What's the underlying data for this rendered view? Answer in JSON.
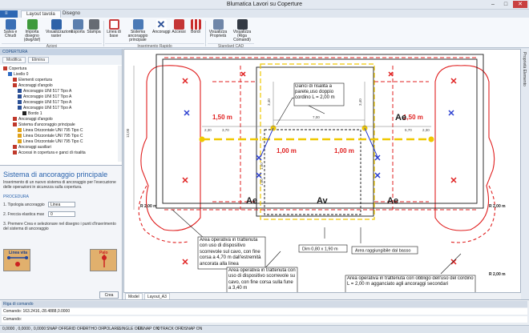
{
  "window": {
    "title": "Blumatica Lavori su Coperture",
    "minimize": "–",
    "maximize": "□",
    "close": "✕"
  },
  "tabs": [
    {
      "label": "Layout tavola"
    },
    {
      "label": "Disegno"
    }
  ],
  "ribbon": {
    "buttons": [
      {
        "label": "Salva e Chiudi",
        "icon": "save-icon",
        "color": "#3a6fb5"
      },
      {
        "label": "Importa disegno (dwg/dxf)",
        "icon": "import-icon",
        "color": "#3f9a3c"
      },
      {
        "label": "Visualizzazione raster",
        "icon": "raster-icon",
        "color": "#2d62a8"
      },
      {
        "label": "Esporta",
        "icon": "export-icon",
        "color": "#5b7fae"
      },
      {
        "label": "Stampa",
        "icon": "print-icon",
        "color": "#666b73"
      },
      {
        "label": "Linea di base",
        "icon": "baseline-icon",
        "color": "#c83b3b"
      },
      {
        "label": "Sistema ancoraggio principale",
        "icon": "anchor-system-icon",
        "color": "#4b7ab6"
      },
      {
        "label": "Ancoraggi",
        "icon": "anchor-x-icon",
        "color": "#2a4f96"
      },
      {
        "label": "Accessi",
        "icon": "access-icon",
        "color": "#c43535"
      },
      {
        "label": "Bordi",
        "icon": "edges-icon",
        "color": "#c92d2d"
      },
      {
        "label": "Visualizza Proprietà",
        "icon": "properties-icon",
        "color": "#6f86a8"
      },
      {
        "label": "Visualizza (Riga Comandi)",
        "icon": "command-line-icon",
        "color": "#333a44"
      }
    ],
    "groups": [
      {
        "label": "Azioni"
      },
      {
        "label": "Inserimento Rapido"
      },
      {
        "label": "Standard CAD"
      }
    ]
  },
  "left_panel": {
    "header": "COPERTURA",
    "tree_buttons": [
      "Modifica",
      "Elimina"
    ],
    "tree": [
      {
        "label": "Copertura",
        "level": 0,
        "color": "#c0392b"
      },
      {
        "label": "Livello 0",
        "level": 1,
        "color": "#2e6bc4"
      },
      {
        "label": "Elementi copertura",
        "level": 2,
        "color": "#c0392b"
      },
      {
        "label": "Ancoraggi d'angolo",
        "level": 2,
        "color": "#c0392b"
      },
      {
        "label": "Ancoraggio UNI 517 Tipo A",
        "level": 3,
        "color": "#2a4f96"
      },
      {
        "label": "Ancoraggio UNI 517 Tipo A",
        "level": 3,
        "color": "#2a4f96"
      },
      {
        "label": "Ancoraggio UNI 517 Tipo A",
        "level": 3,
        "color": "#2a4f96"
      },
      {
        "label": "Ancoraggio UNI 517 Tipo A",
        "level": 3,
        "color": "#2a4f96"
      },
      {
        "label": "Bordo 1",
        "level": 4,
        "color": "#222222"
      },
      {
        "label": "Ancoraggi d'angolo",
        "level": 2,
        "color": "#c0392b"
      },
      {
        "label": "Sistema d'ancoraggio principale",
        "level": 2,
        "color": "#c0392b"
      },
      {
        "label": "Linea Orizzontale UNI 795 Tipo C",
        "level": 3,
        "color": "#e0a21a"
      },
      {
        "label": "Linea Orizzontale UNI 795 Tipo C",
        "level": 3,
        "color": "#e0a21a"
      },
      {
        "label": "Linea Orizzontale UNI 795 Tipo C",
        "level": 3,
        "color": "#e0a21a"
      },
      {
        "label": "Ancoraggi ausiliari",
        "level": 2,
        "color": "#c0392b"
      },
      {
        "label": "Accessi in copertura e ganci di risalita",
        "level": 2,
        "color": "#c0392b"
      }
    ],
    "info": {
      "title": "Sistema di ancoraggio principale",
      "description": "Inserimento di un nuovo sistema di ancoraggio per l'esecuzione delle operazioni in sicurezza sulla copertura.",
      "procedure_label": "PROCEDURA",
      "step1_label": "1. Tipologia ancoraggio",
      "step1_value": "Linea",
      "step2_label": "2. Freccia elastica max",
      "step2_value": "0",
      "step3_text": "3. Premere Crea e selezionare nel disegno i punti d'inserimento del sistema di ancoraggio",
      "image1_label": "Linea vita",
      "image2_label": "Palo",
      "create_button": "Crea"
    }
  },
  "drawing": {
    "labels_150": [
      "1,50 m",
      "1,50 m"
    ],
    "labels_100": [
      "1,00 m",
      "1,00 m"
    ],
    "label_ae": [
      "Ae",
      "Ae",
      "Ae",
      "Ae"
    ],
    "label_av": "Av",
    "garici_note": "Ganci di risalita a parete,uso doppio cordino L = 2,00 m",
    "dim_note": "Dim 0,80 x 1,90 m",
    "area_bas_note": "Area raggiungibile dal basso",
    "area_note_1": "Area operativa in trattenuta con uso di dispositivo scorrevole sul cavo, con fine corsa a 4,70 m dall'estremità ancorata alla linea",
    "area_note_2": "Area operativa in trattenuta con uso di dispositivo scorrevole su cavo, con fine corsa sulla fune a 3,40 m",
    "area_note_3": "Area operativa in trattenuta con obbligo dell'uso del cordino L = 2,00 m agganciato agli ancoraggi secondari",
    "radius_labels": [
      "R 2,00 m",
      "R 2,00 m",
      "R 2,00 m"
    ],
    "dims": [
      "7,00",
      "2,30",
      "3,70",
      "5,70",
      "2,30",
      "12,00",
      "3,40",
      "1,00",
      "1,50",
      "3,40"
    ],
    "colors": {
      "red": "#e02020",
      "blue": "#2b3fd0",
      "yellow": "#f0c800",
      "black": "#1a1a1a"
    }
  },
  "right_bar": "Proprietà Elemento",
  "model_tabs": [
    "Model",
    "Layout_A3"
  ],
  "command_area": {
    "header": "Riga di comando",
    "line1": "Comando: 163.2416,-28.4888,0.0000",
    "line2": "Comando:"
  },
  "status_bar": {
    "coords": "0,0000 , 0,0000 , 0,0000",
    "toggles": [
      "SNAP OFF",
      "GRID OFF",
      "ORTHO OFF",
      "POLARE",
      "SINGLE OFF",
      "OSNAP ON",
      "OTRACK OFF",
      "OSNAP ON"
    ]
  }
}
